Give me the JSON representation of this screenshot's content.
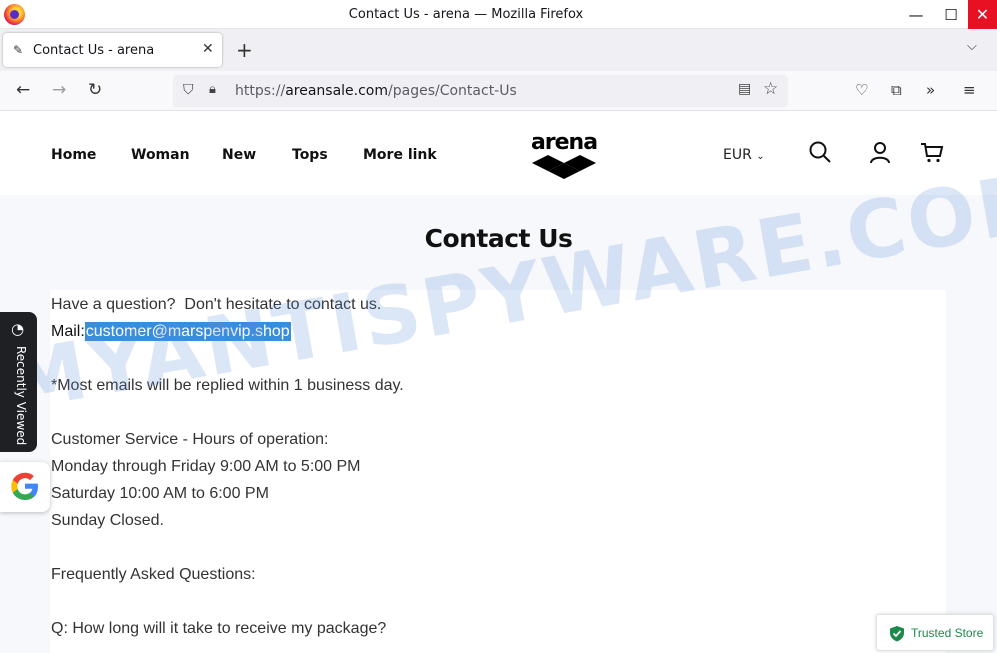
{
  "window": {
    "title": "Contact Us - arena — Mozilla Firefox",
    "controls": {
      "minimize": "—",
      "maximize": "☐",
      "close": "✕"
    }
  },
  "tabs": [
    {
      "title": "Contact Us - arena",
      "active": true
    }
  ],
  "tabstrip": {
    "new_tab": "+",
    "list_all": "⌵"
  },
  "navbar": {
    "url_prefix": "https://",
    "url_host": "areansale.com",
    "url_path": "/pages/Contact-Us"
  },
  "site": {
    "nav": [
      "Home",
      "Woman",
      "New",
      "Tops",
      "More link"
    ],
    "logo": "arena",
    "currency": "EUR"
  },
  "page": {
    "heading": "Contact Us",
    "lines": {
      "intro": "Have a question?  Don't hesitate to contact us.",
      "mail_label": "Mail:",
      "mail_address": "customer@marspenvip.shop",
      "reply_note": "*Most emails will be replied within 1 business day.",
      "hours_title": "Customer Service - Hours of operation:",
      "hours_weekdays": "Monday through Friday 9:00 AM to 5:00 PM",
      "hours_saturday": "Saturday 10:00 AM to 6:00 PM",
      "hours_sunday": "Sunday Closed.",
      "faq_title": "Frequently Asked Questions:",
      "faq_q1": "Q: How long will it take to receive my package?"
    }
  },
  "widgets": {
    "recently_viewed": "Recently Viewed",
    "trusted_store": "Trusted Store"
  },
  "watermark": "MYANTISPYWARE.COM"
}
